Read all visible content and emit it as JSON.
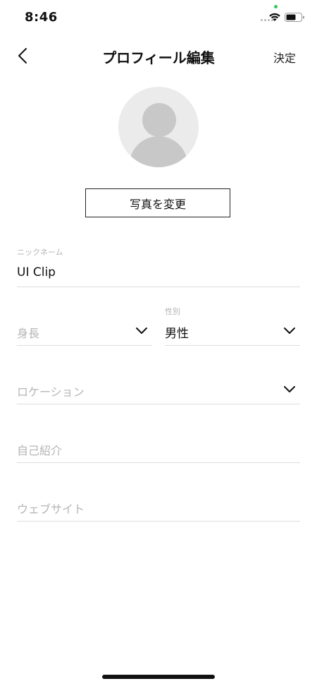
{
  "status": {
    "time": "8:46"
  },
  "nav": {
    "title": "プロフィール編集",
    "action": "決定"
  },
  "photo": {
    "change_label": "写真を変更"
  },
  "form": {
    "nickname": {
      "label": "ニックネーム",
      "value": "UI Clip"
    },
    "height": {
      "placeholder": "身長"
    },
    "gender": {
      "label": "性別",
      "value": "男性"
    },
    "location": {
      "placeholder": "ロケーション"
    },
    "bio": {
      "placeholder": "自己紹介"
    },
    "website": {
      "placeholder": "ウェブサイト"
    }
  }
}
